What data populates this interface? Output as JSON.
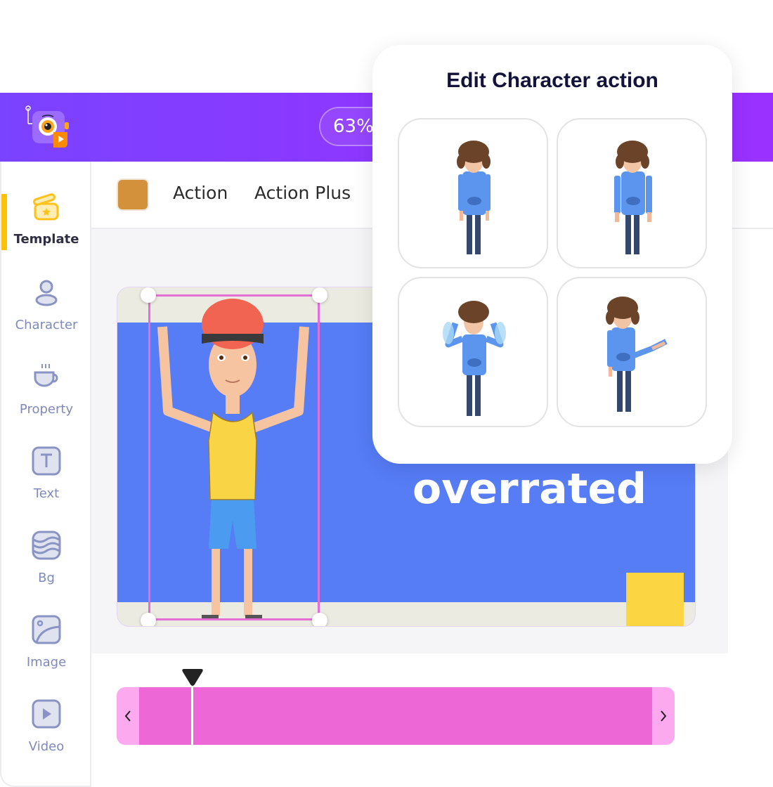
{
  "header": {
    "logo": "app-logo-camera-icon",
    "zoom_level": "63%"
  },
  "sidebar": {
    "active": "Template",
    "items": [
      {
        "label": "Template",
        "icon": "template-box-icon"
      },
      {
        "label": "Character",
        "icon": "person-icon"
      },
      {
        "label": "Property",
        "icon": "coffee-cup-icon"
      },
      {
        "label": "Text",
        "icon": "text-t-icon"
      },
      {
        "label": "Bg",
        "icon": "waves-icon"
      },
      {
        "label": "Image",
        "icon": "image-icon"
      },
      {
        "label": "Video",
        "icon": "video-play-icon"
      }
    ]
  },
  "toolbar": {
    "color_swatch": "#d4913c",
    "links": [
      "Action",
      "Action Plus"
    ]
  },
  "scene": {
    "text": "overrated",
    "colors": {
      "background": "#567cf6",
      "floor": "#ebebe1",
      "accent": "#fbd642",
      "selection": "#e56fd6"
    }
  },
  "timeline": {
    "prev_label": "‹",
    "next_label": "›",
    "track_color": "#ee67d6"
  },
  "popup": {
    "title": "Edit Character action",
    "actions": [
      {
        "name": "standing-idle"
      },
      {
        "name": "standing-arms-down"
      },
      {
        "name": "hands-on-head-crying"
      },
      {
        "name": "presenting-gesture"
      }
    ]
  }
}
